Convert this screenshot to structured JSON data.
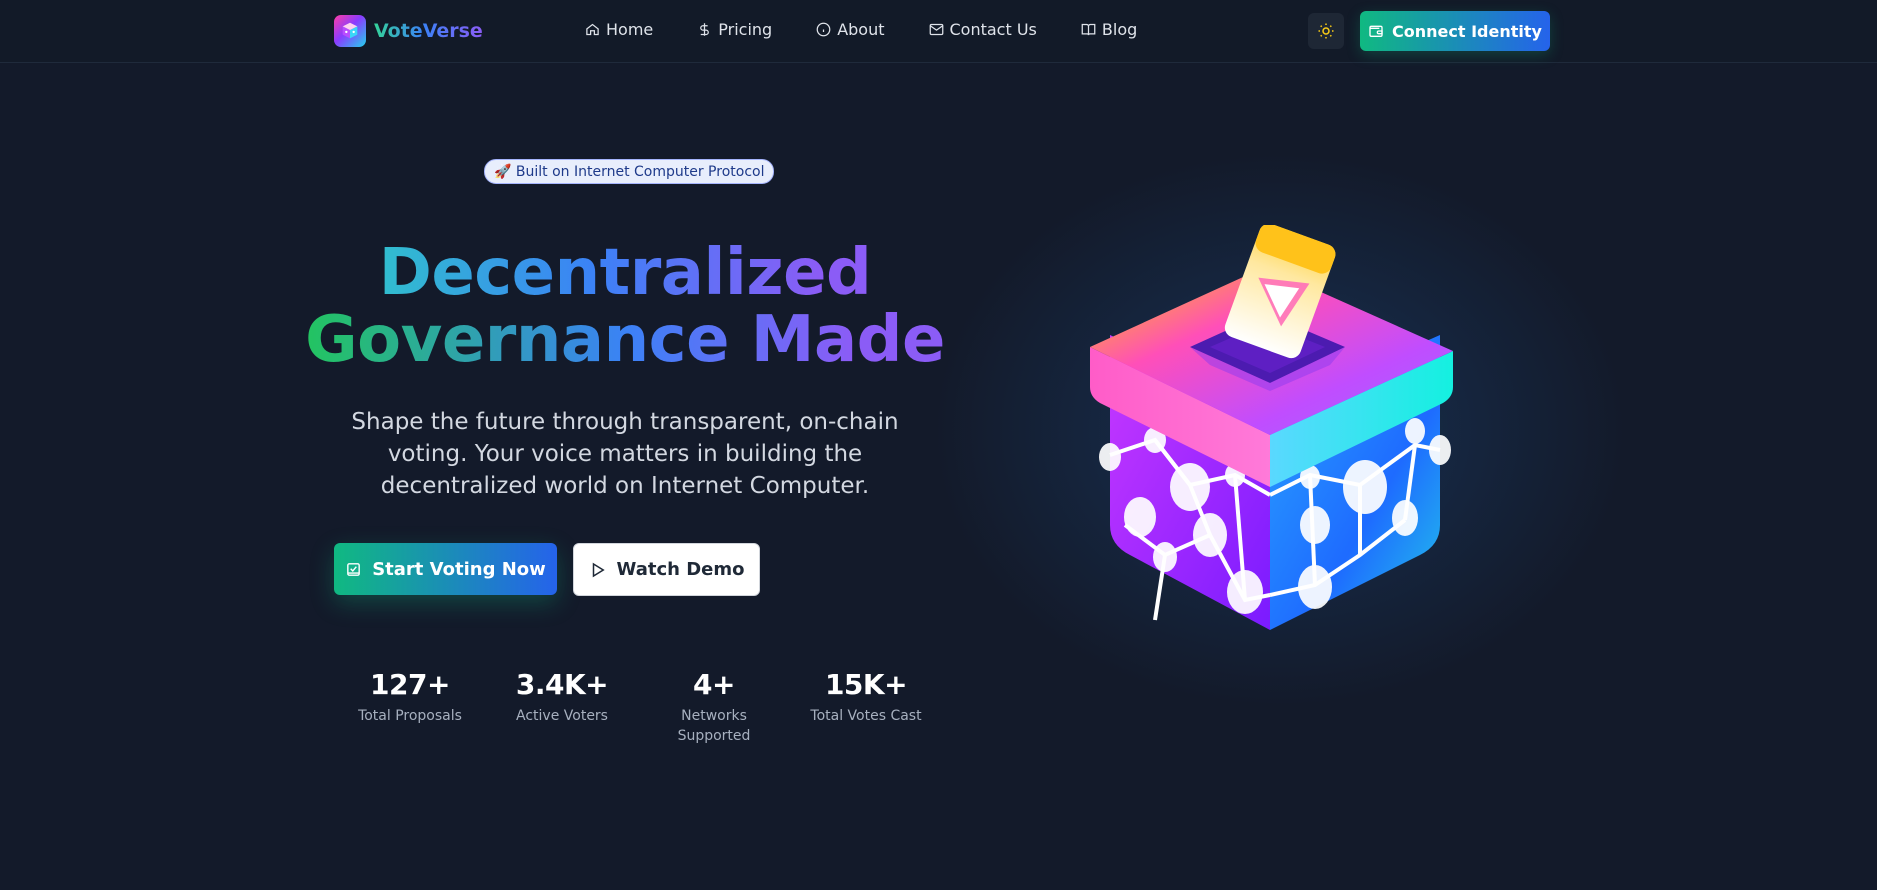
{
  "brand": {
    "name": "VoteVerse",
    "logo_icon": "cube-logo-icon"
  },
  "nav": {
    "links": [
      {
        "label": "Home",
        "icon": "home-icon"
      },
      {
        "label": "Pricing",
        "icon": "dollar-icon"
      },
      {
        "label": "About",
        "icon": "info-icon"
      },
      {
        "label": "Contact Us",
        "icon": "mail-icon"
      },
      {
        "label": "Blog",
        "icon": "book-icon"
      }
    ],
    "theme_toggle_icon": "sun-icon",
    "connect_label": "Connect Identity",
    "connect_icon": "wallet-icon"
  },
  "hero": {
    "badge": "🚀 Built on Internet Computer Protocol",
    "headline_line1": "Decentralized",
    "headline_line2": "Governance Made",
    "subtitle": "Shape the future through transparent, on-chain voting. Your voice matters in building the decentralized world on Internet Computer.",
    "primary_button": "Start Voting Now",
    "primary_icon": "vote-icon",
    "secondary_button": "Watch Demo",
    "secondary_icon": "play-icon"
  },
  "stats": [
    {
      "value": "127+",
      "label": "Total Proposals"
    },
    {
      "value": "3.4K+",
      "label": "Active Voters"
    },
    {
      "value": "4+",
      "label": "Networks Supported"
    },
    {
      "value": "15K+",
      "label": "Total Votes Cast"
    }
  ],
  "colors": {
    "background": "#131a2a",
    "accent_green": "#10b981",
    "accent_blue": "#2563eb",
    "accent_purple": "#8b5cf6"
  }
}
